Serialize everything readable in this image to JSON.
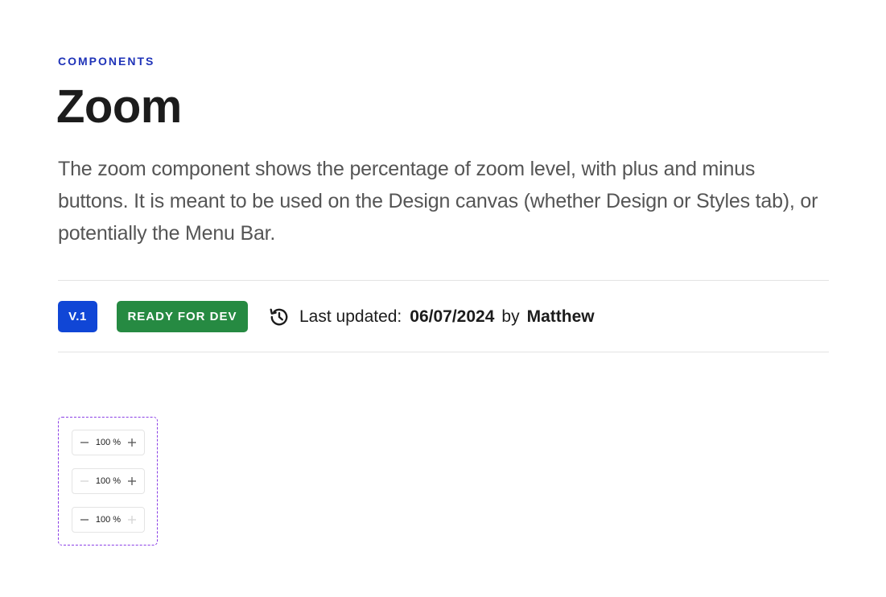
{
  "header": {
    "eyebrow": "COMPONENTS",
    "title": "Zoom",
    "description": "The zoom component shows the percentage of zoom level, with plus and minus buttons. It is meant to be used on the Design canvas (whether Design or Styles tab), or potentially the Menu Bar."
  },
  "meta": {
    "version_badge": "V.1",
    "status_badge": "READY FOR DEV",
    "history_icon": "history-icon",
    "last_updated_label": "Last updated:",
    "date": "06/07/2024",
    "by_label": "by",
    "author": "Matthew"
  },
  "colors": {
    "eyebrow": "#1f33b8",
    "version_badge": "#1046d6",
    "status_badge": "#268a42",
    "showcase_border": "#8a3ee6",
    "control_enabled": "#555555",
    "control_disabled": "#d4d4d4"
  },
  "zoom_controls": [
    {
      "value": "100 %",
      "minus_state": "enabled",
      "plus_state": "enabled",
      "minus_icon": "minus-icon",
      "plus_icon": "plus-icon"
    },
    {
      "value": "100 %",
      "minus_state": "disabled",
      "plus_state": "enabled",
      "minus_icon": "minus-icon",
      "plus_icon": "plus-icon"
    },
    {
      "value": "100 %",
      "minus_state": "enabled",
      "plus_state": "disabled",
      "minus_icon": "minus-icon",
      "plus_icon": "plus-icon"
    }
  ]
}
